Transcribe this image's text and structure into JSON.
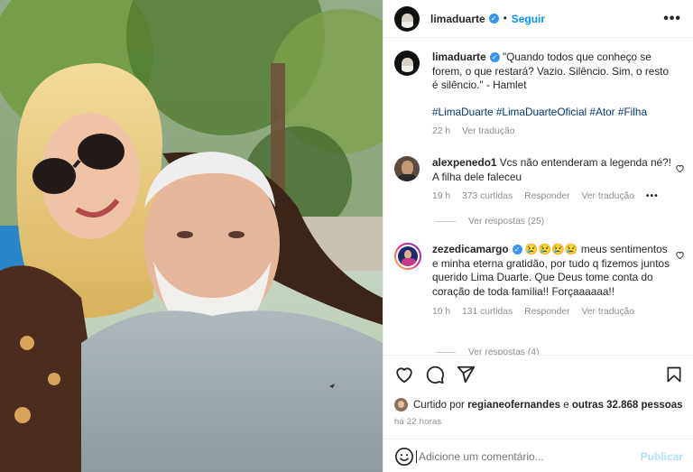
{
  "header": {
    "username": "limaduarte",
    "follow_label": "Seguir",
    "separator": "•",
    "more_label": "•••"
  },
  "caption": {
    "username": "limaduarte",
    "text": "\"Quando todos que conheço se forem, o que restará? Vazio. Silêncio. Sim, o resto é silêncio.\" - Hamlet",
    "hashtags": "#LimaDuarte #LimaDuarteOficial #Ator #Filha",
    "time": "22 h",
    "see_translation": "Ver tradução"
  },
  "comments": [
    {
      "username": "alexpenedo1",
      "text": "Vcs não entenderam a legenda né?! A filha dele faleceu",
      "time": "19 h",
      "likes": "373 curtidas",
      "reply": "Responder",
      "translate": "Ver tradução",
      "more": "•••",
      "view_replies": "Ver respostas (25)"
    },
    {
      "username": "zezedicamargo",
      "emojis": "😢😢😢😢",
      "text": "meus sentimentos e minha eterna gratidão, por tudo q fizemos juntos querido Lima Duarte. Que Deus tome conta do coração de toda família!! Forçaaaaaa!!",
      "time": "10 h",
      "likes": "131 curtidas",
      "reply": "Responder",
      "translate": "Ver tradução",
      "view_replies": "Ver respostas (4)"
    }
  ],
  "likes_line": {
    "prefix": "Curtido por",
    "user": "regianeofernandes",
    "middle": "e",
    "others": "outras 32.868 pessoas"
  },
  "time_ago": "há 22 horas",
  "add_comment": {
    "placeholder": "Adicione um comentário...",
    "publish": "Publicar"
  },
  "icons": {
    "like": "heart-icon",
    "comment": "comment-icon",
    "share": "share-icon",
    "save": "bookmark-icon",
    "emoji": "emoji-icon",
    "more": "more-icon"
  },
  "colors": {
    "link_blue": "#0095f6",
    "hashtag": "#00376b",
    "muted": "#8e8e8e",
    "publish_disabled": "#b2dffc"
  }
}
